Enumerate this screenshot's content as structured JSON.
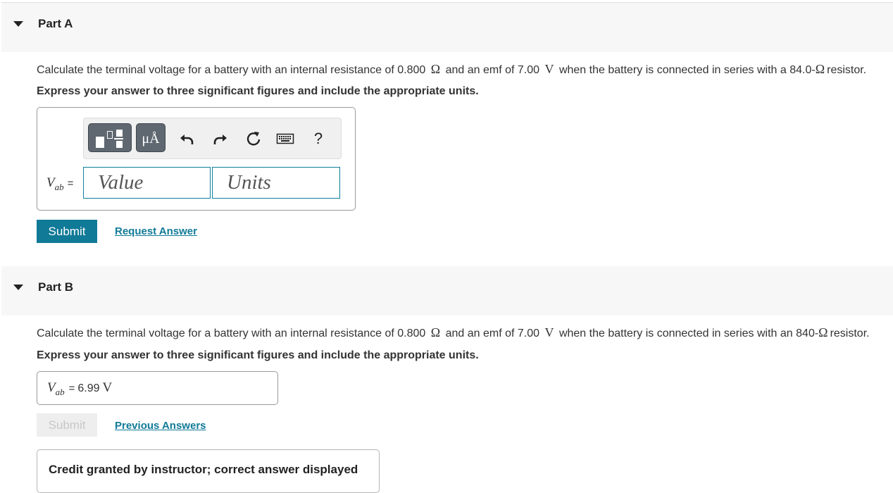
{
  "part_a": {
    "title": "Part A",
    "question_before": "Calculate the terminal voltage for a battery with an internal resistance of 0.800",
    "ohm": "Ω",
    "question_mid": "and an emf of 7.00",
    "volt": "V",
    "question_after": "when the battery is connected in series with a 84.0-",
    "question_end": "resistor.",
    "instruction": "Express your answer to three significant figures and include the appropriate units.",
    "toolbar": {
      "icons": [
        "templates-icon",
        "units-icon",
        "undo-icon",
        "redo-icon",
        "reset-icon",
        "keyboard-icon",
        "help-icon"
      ],
      "units_glyph": "μÅ",
      "help_glyph": "?"
    },
    "variable": "V",
    "variable_sub": "ab",
    "equals": "=",
    "value_placeholder": "Value",
    "units_placeholder": "Units",
    "submit_label": "Submit",
    "request_answer_label": "Request Answer"
  },
  "part_b": {
    "title": "Part B",
    "question_before": "Calculate the terminal voltage for a battery with an internal resistance of 0.800",
    "ohm": "Ω",
    "question_mid": "and an emf of 7.00",
    "volt": "V",
    "question_after": "when the battery is connected in series with an 840-",
    "question_end": "resistor.",
    "instruction": "Express your answer to three significant figures and include the appropriate units.",
    "variable": "V",
    "variable_sub": "ab",
    "equals": "=",
    "answer_value": "6.99",
    "answer_unit": "V",
    "submit_label": "Submit",
    "previous_answers_label": "Previous Answers",
    "credit_text": "Credit granted by instructor; correct answer displayed"
  },
  "colors": {
    "accent": "#107a97",
    "header_bg": "#f7f7f7",
    "toolbar_button": "#5f6870"
  }
}
